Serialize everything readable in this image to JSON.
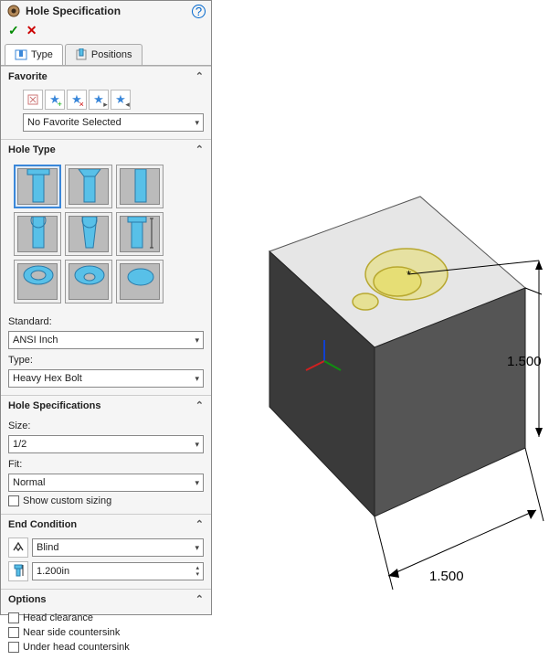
{
  "panel": {
    "title": "Hole Specification",
    "accept_label": "✓",
    "cancel_label": "✕",
    "help_label": "?"
  },
  "tabs": {
    "type": "Type",
    "positions": "Positions"
  },
  "favorite": {
    "header": "Favorite",
    "dropdown": "No Favorite Selected"
  },
  "holeType": {
    "header": "Hole Type",
    "standard_label": "Standard:",
    "standard_value": "ANSI Inch",
    "type_label": "Type:",
    "type_value": "Heavy Hex Bolt"
  },
  "holeSpec": {
    "header": "Hole Specifications",
    "size_label": "Size:",
    "size_value": "1/2",
    "fit_label": "Fit:",
    "fit_value": "Normal",
    "custom_label": "Show custom sizing"
  },
  "endCond": {
    "header": "End Condition",
    "value": "Blind",
    "depth": "1.200in"
  },
  "options": {
    "header": "Options",
    "head_clearance": "Head clearance",
    "near_cs": "Near side countersink",
    "under_cs": "Under head countersink"
  },
  "viewport": {
    "dim1": "1.500",
    "dim2": "1.500"
  }
}
